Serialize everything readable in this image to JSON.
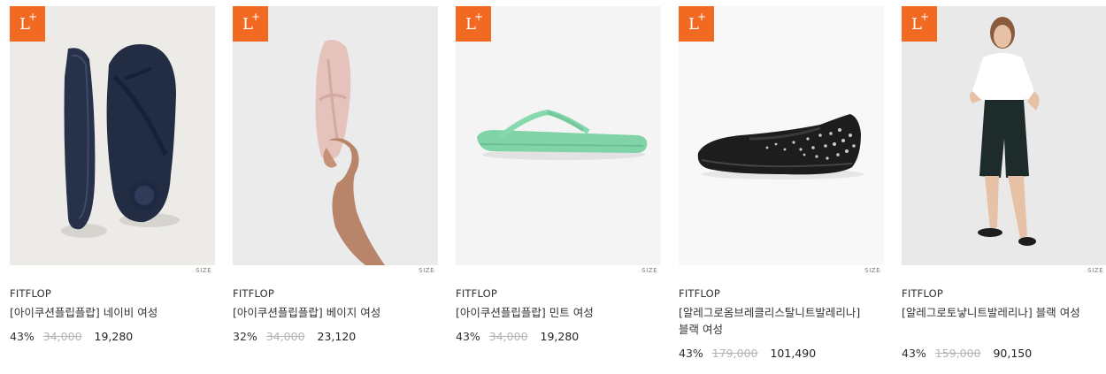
{
  "products": [
    {
      "badge": {
        "letter": "L",
        "plus": "+"
      },
      "size_tag": "SIZE",
      "brand": "FITFLOP",
      "name": "[아이쿠션플립플랍] 네이비 여성",
      "discount": "43%",
      "original_price": "34,000",
      "sale_price": "19,280",
      "image": "navy-flip-flops",
      "image_bg": "#ecebe7",
      "product_color": "#27324a"
    },
    {
      "badge": {
        "letter": "L",
        "plus": "+"
      },
      "size_tag": "SIZE",
      "brand": "FITFLOP",
      "name": "[아이쿠션플립플랍] 베이지 여성",
      "discount": "32%",
      "original_price": "34,000",
      "sale_price": "23,120",
      "image": "beige-flip-flop-in-hand",
      "image_bg": "#ebebeb",
      "product_color": "#e6c2bc"
    },
    {
      "badge": {
        "letter": "L",
        "plus": "+"
      },
      "size_tag": "SIZE",
      "brand": "FITFLOP",
      "name": "[아이쿠션플립플랍] 민트 여성",
      "discount": "43%",
      "original_price": "34,000",
      "sale_price": "19,280",
      "image": "mint-flip-flop",
      "image_bg": "#f4f4f4",
      "product_color": "#7fd3a6"
    },
    {
      "badge": {
        "letter": "L",
        "plus": "+"
      },
      "size_tag": "SIZE",
      "brand": "FITFLOP",
      "name": "[알레그로옴브레클리스탈니트발레리나] 블랙 여성",
      "discount": "43%",
      "original_price": "179,000",
      "sale_price": "101,490",
      "image": "black-knit-ballerina",
      "image_bg": "#f8f8f8",
      "product_color": "#1d1d1d"
    },
    {
      "badge": {
        "letter": "L",
        "plus": "+"
      },
      "size_tag": "SIZE",
      "brand": "FITFLOP",
      "name": "[알레그로토냫니트발레리나] 블랙 여성",
      "discount": "43%",
      "original_price": "159,000",
      "sale_price": "90,150",
      "image": "model-wearing-ballerina",
      "image_bg": "#e9e9e9",
      "product_color": "#1d2b2a"
    }
  ]
}
